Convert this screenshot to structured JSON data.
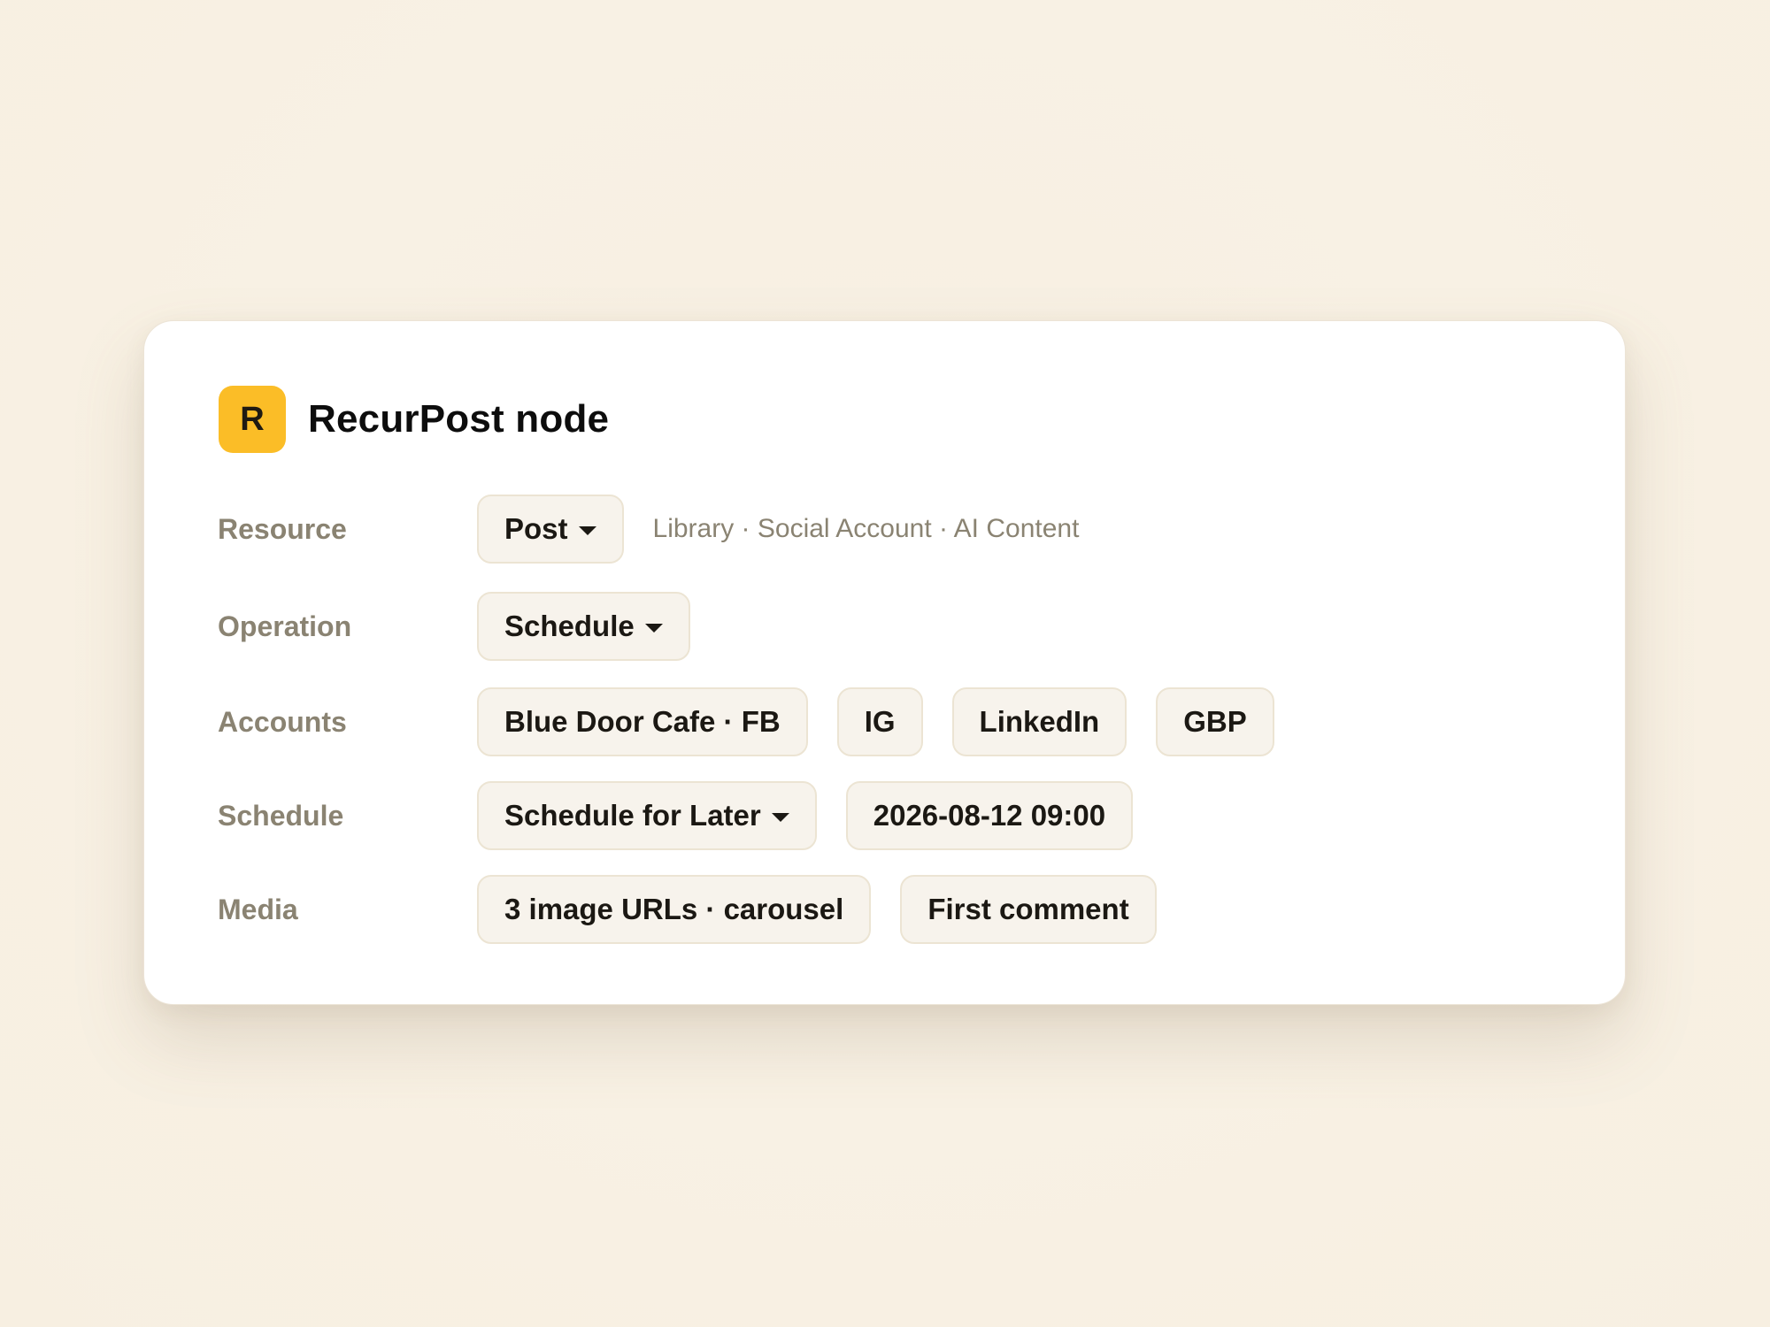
{
  "node": {
    "logo_letter": "R",
    "title": "RecurPost node",
    "accent_color": "#fbbd27"
  },
  "rows": {
    "resource": {
      "label": "Resource",
      "value": "Post",
      "hint": "Library · Social Account · AI Content"
    },
    "operation": {
      "label": "Operation",
      "value": "Schedule"
    },
    "accounts": {
      "label": "Accounts",
      "items": [
        "Blue Door Cafe · FB",
        "IG",
        "LinkedIn",
        "GBP"
      ]
    },
    "schedule": {
      "label": "Schedule",
      "mode": "Schedule for Later",
      "datetime": "2026-08-12 09:00"
    },
    "media": {
      "label": "Media",
      "items": [
        "3 image URLs · carousel",
        "First comment"
      ]
    }
  },
  "icons": {
    "dropdown": "caret-down-icon"
  }
}
